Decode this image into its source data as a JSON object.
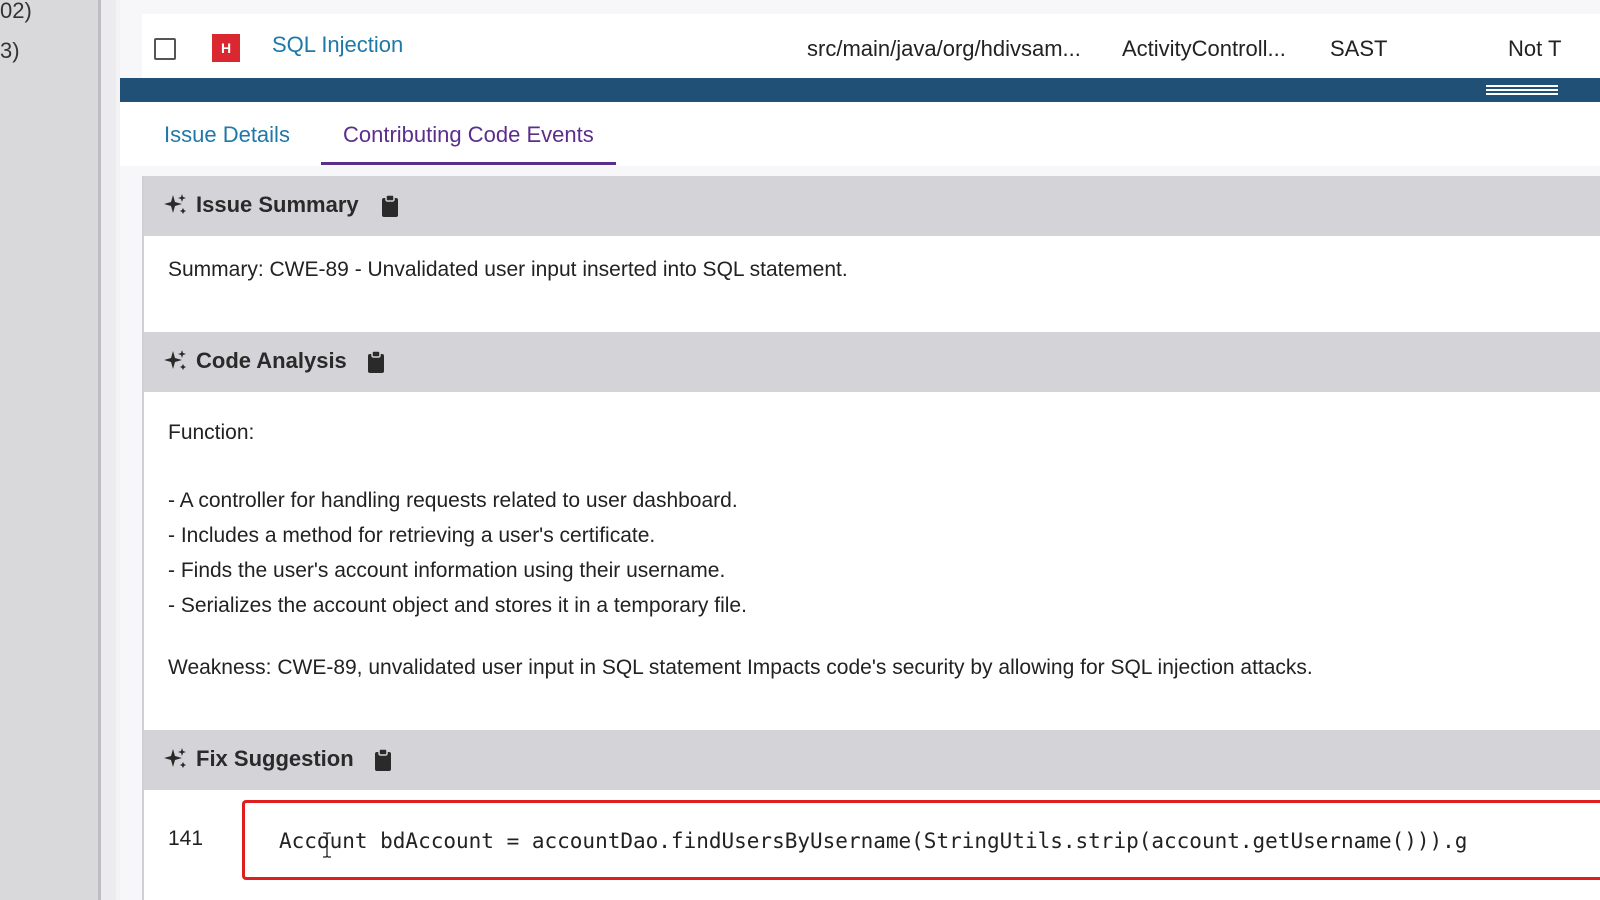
{
  "sidebar": {
    "fragments": [
      "02)",
      "3)"
    ]
  },
  "issue_row": {
    "severity": "H",
    "severity_color": "#d9282f",
    "title": "SQL Injection",
    "path": "src/main/java/org/hdivsam...",
    "file": "ActivityControll...",
    "type": "SAST",
    "status": "Not T"
  },
  "tabs": [
    {
      "label": "Issue Details",
      "active": false
    },
    {
      "label": "Contributing Code Events",
      "active": true
    }
  ],
  "sections": {
    "summary": {
      "title": "Issue Summary",
      "text": "Summary: CWE-89 - Unvalidated user input inserted into SQL statement."
    },
    "analysis": {
      "title": "Code Analysis",
      "function_label": "Function:",
      "bullets": [
        "- A controller for handling requests related to user dashboard.",
        "- Includes a method for retrieving a user's certificate.",
        "- Finds the user's account information using their username.",
        "- Serializes the account object and stores it in a temporary file."
      ],
      "weakness": "Weakness: CWE-89, unvalidated user input in SQL statement Impacts code's security by allowing for SQL injection attacks."
    },
    "fix": {
      "title": "Fix Suggestion",
      "line_number": "141",
      "code": "Account bdAccount = accountDao.findUsersByUsername(StringUtils.strip(account.getUsername())).g"
    }
  },
  "colors": {
    "accent_blue": "#215076",
    "link": "#1e78a8",
    "active_tab": "#5b2e8c",
    "highlight_border": "#e01e1e"
  }
}
